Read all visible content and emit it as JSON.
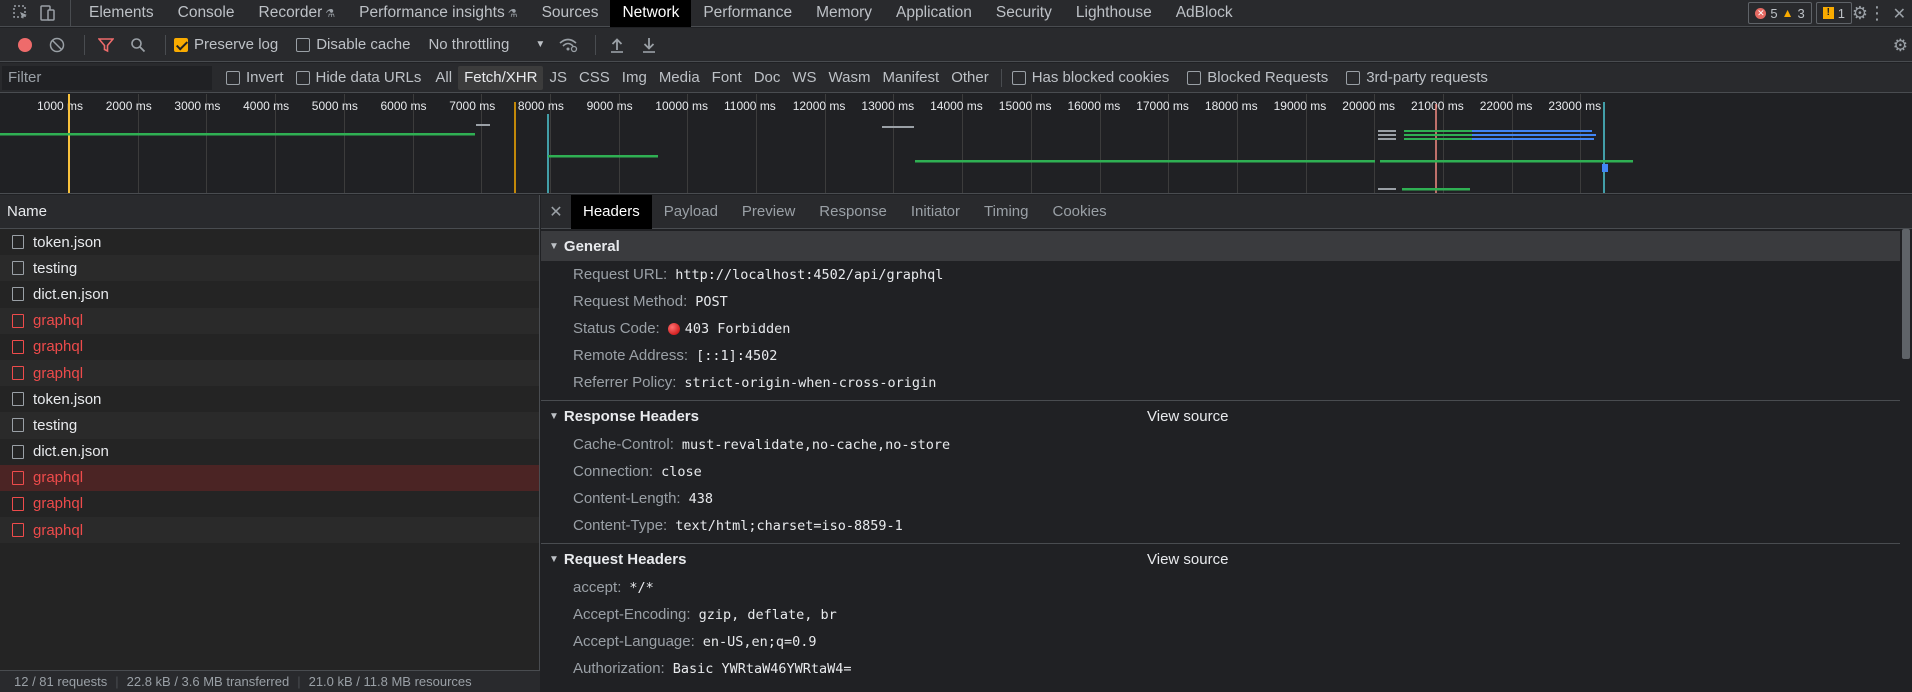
{
  "tabs": [
    {
      "label": "Elements"
    },
    {
      "label": "Console"
    },
    {
      "label": "Recorder",
      "flask": true
    },
    {
      "label": "Performance insights",
      "flask": true
    },
    {
      "label": "Sources"
    },
    {
      "label": "Network",
      "active": true
    },
    {
      "label": "Performance"
    },
    {
      "label": "Memory"
    },
    {
      "label": "Application"
    },
    {
      "label": "Security"
    },
    {
      "label": "Lighthouse"
    },
    {
      "label": "AdBlock"
    }
  ],
  "badges": {
    "errors": "5",
    "warnings": "3",
    "issues": "1"
  },
  "toolbar": {
    "preserve_log": "Preserve log",
    "disable_cache": "Disable cache",
    "throttling": "No throttling"
  },
  "filterbar": {
    "placeholder": "Filter",
    "invert": "Invert",
    "hide_data_urls": "Hide data URLs",
    "types": [
      "All",
      "Fetch/XHR",
      "JS",
      "CSS",
      "Img",
      "Media",
      "Font",
      "Doc",
      "WS",
      "Wasm",
      "Manifest",
      "Other"
    ],
    "active_type": "Fetch/XHR",
    "blocked_cookies": "Has blocked cookies",
    "blocked_requests": "Blocked Requests",
    "third_party": "3rd-party requests"
  },
  "timeline": {
    "ticks": [
      "1000 ms",
      "2000 ms",
      "3000 ms",
      "4000 ms",
      "5000 ms",
      "6000 ms",
      "7000 ms",
      "8000 ms",
      "9000 ms",
      "10000 ms",
      "11000 ms",
      "12000 ms",
      "13000 ms",
      "14000 ms",
      "15000 ms",
      "16000 ms",
      "17000 ms",
      "18000 ms",
      "19000 ms",
      "20000 ms",
      "21000 ms",
      "22000 ms",
      "23000 ms"
    ]
  },
  "requests": {
    "column": "Name",
    "rows": [
      {
        "name": "token.json",
        "error": false
      },
      {
        "name": "testing",
        "error": false
      },
      {
        "name": "dict.en.json",
        "error": false
      },
      {
        "name": "graphql",
        "error": true
      },
      {
        "name": "graphql",
        "error": true
      },
      {
        "name": "graphql",
        "error": true
      },
      {
        "name": "token.json",
        "error": false
      },
      {
        "name": "testing",
        "error": false
      },
      {
        "name": "dict.en.json",
        "error": false
      },
      {
        "name": "graphql",
        "error": true,
        "selected": true
      },
      {
        "name": "graphql",
        "error": true
      },
      {
        "name": "graphql",
        "error": true
      }
    ],
    "status": [
      "12 / 81 requests",
      "22.8 kB / 3.6 MB transferred",
      "21.0 kB / 11.8 MB resources"
    ]
  },
  "details": {
    "tabs": [
      "Headers",
      "Payload",
      "Preview",
      "Response",
      "Initiator",
      "Timing",
      "Cookies"
    ],
    "active_tab": "Headers",
    "general": {
      "title": "General",
      "rows": [
        {
          "key": "Request URL:",
          "value": "http://localhost:4502/api/graphql"
        },
        {
          "key": "Request Method:",
          "value": "POST"
        },
        {
          "key": "Status Code:",
          "value": "403 Forbidden"
        },
        {
          "key": "Remote Address:",
          "value": "[::1]:4502"
        },
        {
          "key": "Referrer Policy:",
          "value": "strict-origin-when-cross-origin"
        }
      ]
    },
    "response_headers": {
      "title": "Response Headers",
      "view_source": "View source",
      "rows": [
        {
          "key": "Cache-Control:",
          "value": "must-revalidate,no-cache,no-store"
        },
        {
          "key": "Connection:",
          "value": "close"
        },
        {
          "key": "Content-Length:",
          "value": "438"
        },
        {
          "key": "Content-Type:",
          "value": "text/html;charset=iso-8859-1"
        }
      ]
    },
    "request_headers": {
      "title": "Request Headers",
      "view_source": "View source",
      "rows": [
        {
          "key": "accept:",
          "value": "*/*"
        },
        {
          "key": "Accept-Encoding:",
          "value": "gzip, deflate, br"
        },
        {
          "key": "Accept-Language:",
          "value": "en-US,en;q=0.9"
        },
        {
          "key": "Authorization:",
          "value": "Basic YWRtaW46YWRtaW4="
        }
      ]
    }
  }
}
